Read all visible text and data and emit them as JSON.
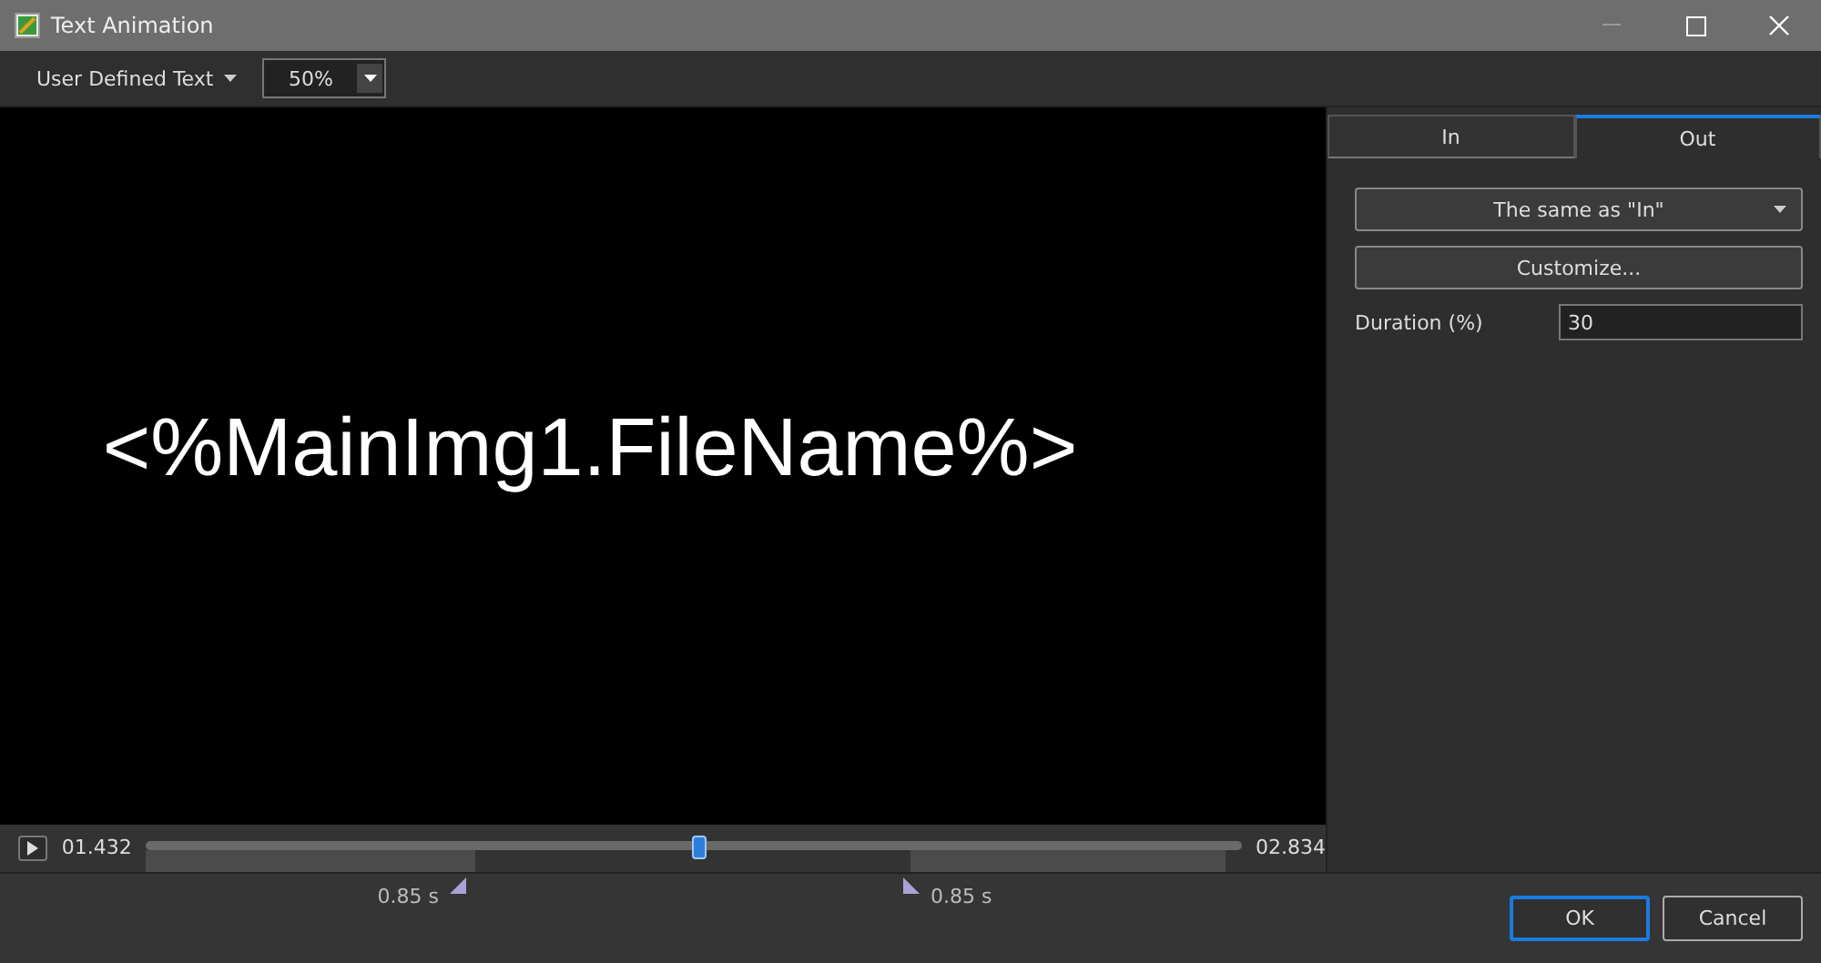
{
  "window": {
    "title": "Text Animation"
  },
  "toolbar": {
    "text_source": "User Defined Text",
    "zoom": "50%"
  },
  "preview": {
    "text": "<%MainImg1.FileName%>"
  },
  "timeline": {
    "start": "01.432",
    "end": "02.834",
    "level": 0.505,
    "markers": [
      {
        "label": "0.85 s",
        "kind": "in"
      },
      {
        "label": "0.85 s",
        "kind": "out"
      }
    ]
  },
  "tabs": [
    {
      "label": "In",
      "selected": false
    },
    {
      "label": "Out",
      "selected": true
    }
  ],
  "effect": {
    "value": "The same as \"In\""
  },
  "customize_button": "Customize...",
  "duration": {
    "label": "Duration (%)",
    "value": "30"
  },
  "buttons": [
    {
      "label": "OK",
      "default": true
    },
    {
      "label": "Cancel",
      "default": false
    }
  ]
}
